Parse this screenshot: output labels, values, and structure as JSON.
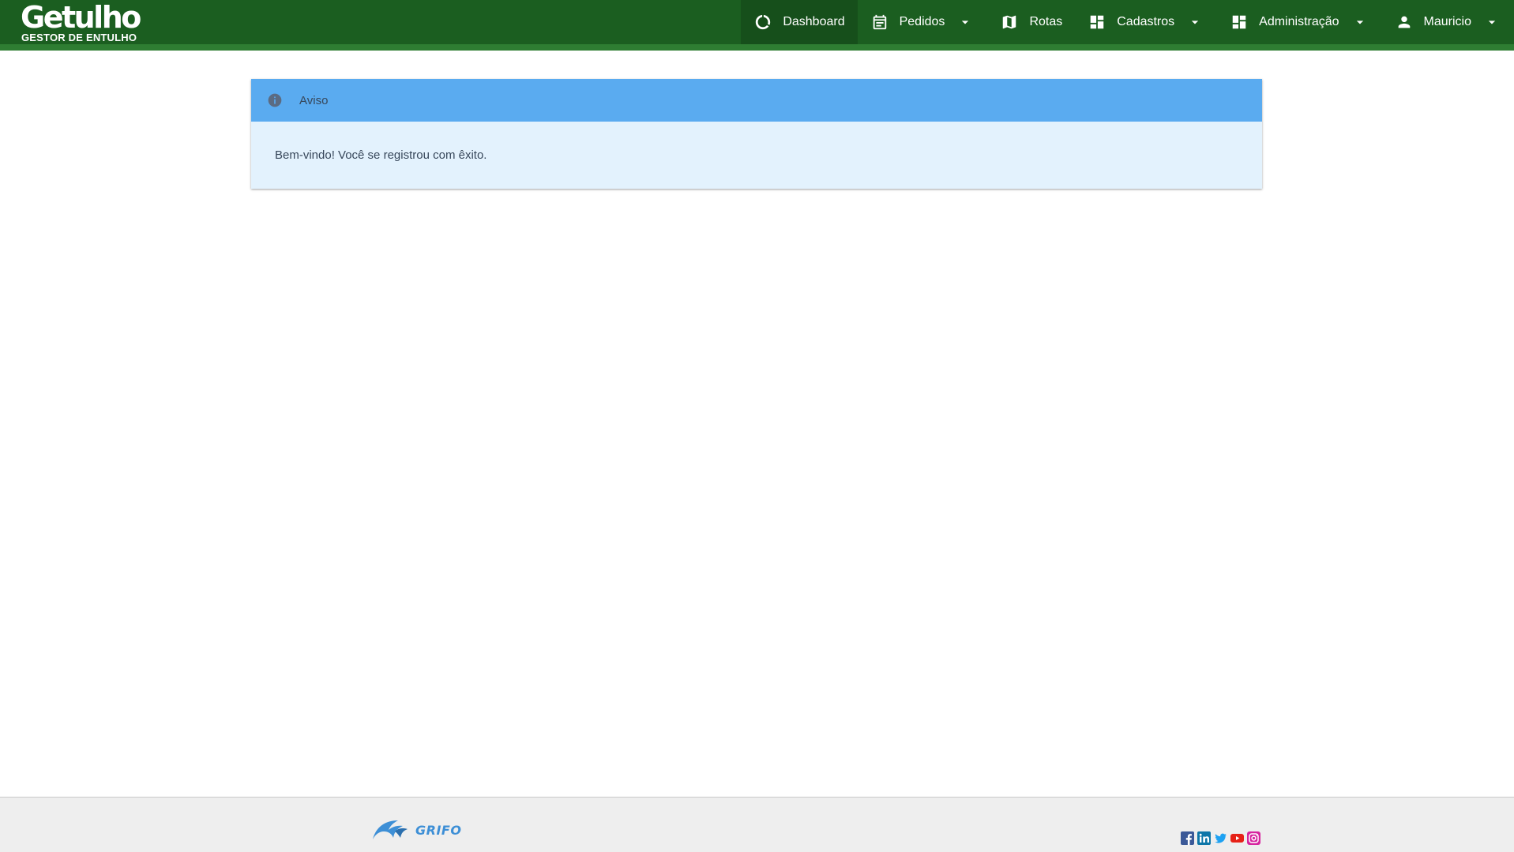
{
  "app": {
    "brand_name": "Getulho",
    "brand_tagline": "GESTOR DE ENTULHO"
  },
  "nav": {
    "items": [
      {
        "label": "Dashboard",
        "icon": "dashboard-circle-icon",
        "active": true,
        "dropdown": false
      },
      {
        "label": "Pedidos",
        "icon": "calendar-icon",
        "active": false,
        "dropdown": true
      },
      {
        "label": "Rotas",
        "icon": "map-icon",
        "active": false,
        "dropdown": false
      },
      {
        "label": "Cadastros",
        "icon": "grid-icon",
        "active": false,
        "dropdown": true
      },
      {
        "label": "Administração",
        "icon": "grid-icon",
        "active": false,
        "dropdown": true
      },
      {
        "label": "Mauricio",
        "icon": "user-icon",
        "active": false,
        "dropdown": true
      }
    ]
  },
  "alert": {
    "title": "Aviso",
    "message": "Bem-vindo! Você se registrou com êxito.",
    "icon": "info-icon"
  },
  "footer": {
    "logo_text": "GRIFO",
    "social": [
      "facebook-icon",
      "linkedin-icon",
      "twitter-icon",
      "youtube-icon",
      "instagram-icon"
    ]
  },
  "colors": {
    "navbar": "#1b5e20",
    "navbar_accent": "#2e7d32",
    "alert_header": "#5aabf0",
    "alert_body": "#e3f2fd",
    "footer": "#eeeeee"
  }
}
